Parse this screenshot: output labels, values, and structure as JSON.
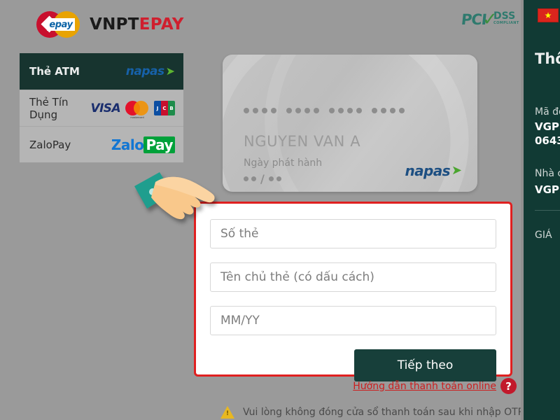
{
  "brand": {
    "logo_icon": "epay-circles-logo",
    "logo_inner_text": "epay",
    "name_part1": "VNPT",
    "name_part2": "EPAY"
  },
  "security_badge": {
    "icon": "pci-dss-compliant-badge",
    "main": "PCI",
    "dss": "DSS",
    "sub": "COMPLIANT"
  },
  "payment_methods": [
    {
      "label": "Thẻ ATM",
      "logo": "napas-logo",
      "logo_text": "napas",
      "active": true
    },
    {
      "label": "Thẻ Tín Dụng",
      "logo": "visa-mastercard-jcb-logos",
      "active": false
    },
    {
      "label": "ZaloPay",
      "logo": "zalopay-logo",
      "logo_text_1": "Zalo",
      "logo_text_2": "Pay",
      "active": false
    }
  ],
  "card_preview": {
    "number_masked_groups": [
      "••••",
      "••••",
      "••••",
      "••••"
    ],
    "holder_name": "NGUYEN VAN A",
    "issue_label": "Ngày phát hành",
    "issue_value": "•• / ••",
    "brand_text": "napas"
  },
  "form": {
    "card_number_placeholder": "Số thẻ",
    "card_number_value": "",
    "card_holder_placeholder": "Tên chủ thẻ (có dấu cách)",
    "card_holder_value": "",
    "expiry_placeholder": "MM/YY",
    "expiry_value": "",
    "submit_label": "Tiếp theo"
  },
  "help": {
    "link_text": "Hướng dẫn thanh toán online",
    "icon": "question-mark-icon"
  },
  "warning": {
    "icon": "warning-triangle-icon",
    "text": "Vui lòng không đóng cửa sổ thanh toán sau khi nhập OTP"
  },
  "order_panel": {
    "flag_icon": "vietnam-flag-icon",
    "title": "Thông tin đơn hàng",
    "order_code_label": "Mã đơn hàng",
    "order_code_value_line1": "VGP",
    "order_code_value_line2": "0643",
    "merchant_label": "Nhà cung cấp",
    "merchant_value": "VGP",
    "price_label": "GIÁ"
  },
  "colors": {
    "dark_teal": "#17342f",
    "button_teal": "#173f3a",
    "red_highlight": "#e02020",
    "brand_red": "#cf1f2e",
    "scrim_gray": "#9a9a9a"
  }
}
